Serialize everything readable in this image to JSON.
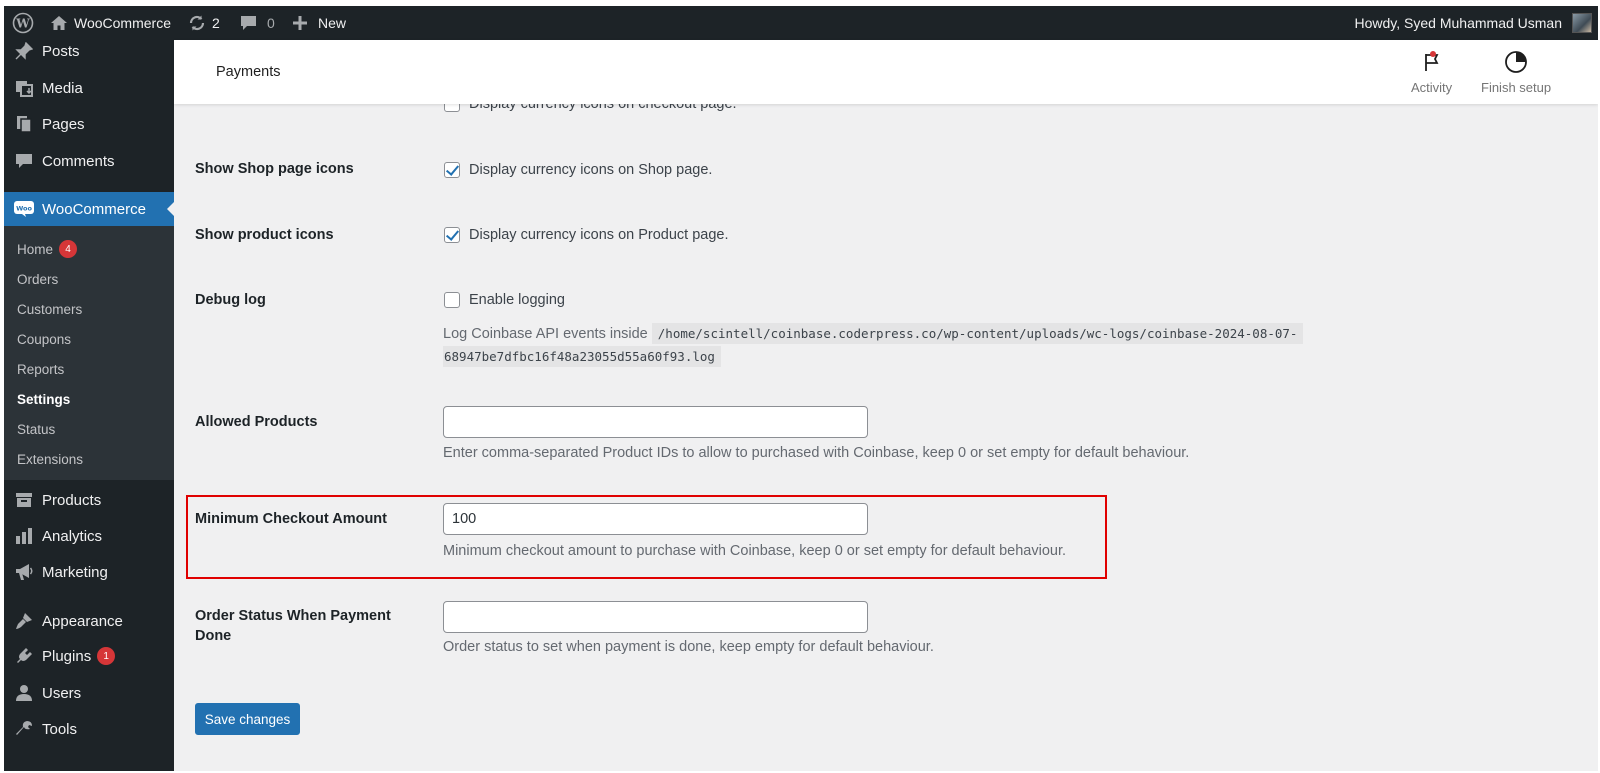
{
  "adminbar": {
    "site_name": "WooCommerce",
    "updates_count": "2",
    "comments_count": "0",
    "new_label": "New",
    "howdy": "Howdy, Syed Muhammad Usman"
  },
  "sidebar": {
    "items": [
      {
        "label": "Posts",
        "icon": "pin-icon"
      },
      {
        "label": "Media",
        "icon": "media-icon"
      },
      {
        "label": "Pages",
        "icon": "pages-icon"
      },
      {
        "label": "Comments",
        "icon": "comments-icon"
      },
      {
        "label": "WooCommerce",
        "icon": "woocommerce-icon"
      },
      {
        "label": "Products",
        "icon": "products-icon"
      },
      {
        "label": "Analytics",
        "icon": "analytics-icon"
      },
      {
        "label": "Marketing",
        "icon": "megaphone-icon"
      },
      {
        "label": "Appearance",
        "icon": "brush-icon"
      },
      {
        "label": "Plugins",
        "icon": "plugin-icon",
        "badge": "1"
      },
      {
        "label": "Users",
        "icon": "user-icon"
      },
      {
        "label": "Tools",
        "icon": "wrench-icon"
      }
    ],
    "submenu": [
      {
        "label": "Home",
        "badge": "4"
      },
      {
        "label": "Orders"
      },
      {
        "label": "Customers"
      },
      {
        "label": "Coupons"
      },
      {
        "label": "Reports"
      },
      {
        "label": "Settings",
        "current": true
      },
      {
        "label": "Status"
      },
      {
        "label": "Extensions"
      }
    ]
  },
  "header": {
    "title": "Payments",
    "activity_label": "Activity",
    "finish_setup_label": "Finish setup"
  },
  "settings": {
    "cut_row_label": "Display currency icons on checkout page.",
    "shop_icons": {
      "label": "Show Shop page icons",
      "checkbox_label": "Display currency icons on Shop page.",
      "checked": true
    },
    "product_icons": {
      "label": "Show product icons",
      "checkbox_label": "Display currency icons on Product page.",
      "checked": true
    },
    "debug_log": {
      "label": "Debug log",
      "checkbox_label": "Enable logging",
      "checked": false,
      "desc_prefix": "Log Coinbase API events inside",
      "path_line1": "/home/scintell/coinbase.coderpress.co/wp-content/uploads/wc-logs/coinbase-2024-08-07-",
      "path_line2": "68947be7dfbc16f48a23055d55a60f93.log"
    },
    "allowed_products": {
      "label": "Allowed Products",
      "value": "",
      "desc": "Enter comma-separated Product IDs to allow to purchased with Coinbase, keep 0 or set empty for default behaviour."
    },
    "minimum_checkout": {
      "label": "Minimum Checkout Amount",
      "value": "100",
      "desc": "Minimum checkout amount to purchase with Coinbase, keep 0 or set empty for default behaviour."
    },
    "order_status": {
      "label_line1": "Order Status When Payment",
      "label_line2": "Done",
      "value": "",
      "desc": "Order status to set when payment is done, keep empty for default behaviour."
    },
    "save_label": "Save changes"
  },
  "colors": {
    "accent": "#2271b1",
    "sidebar_bg": "#1d2327",
    "badge": "#d63638",
    "highlight": "#e00000"
  }
}
